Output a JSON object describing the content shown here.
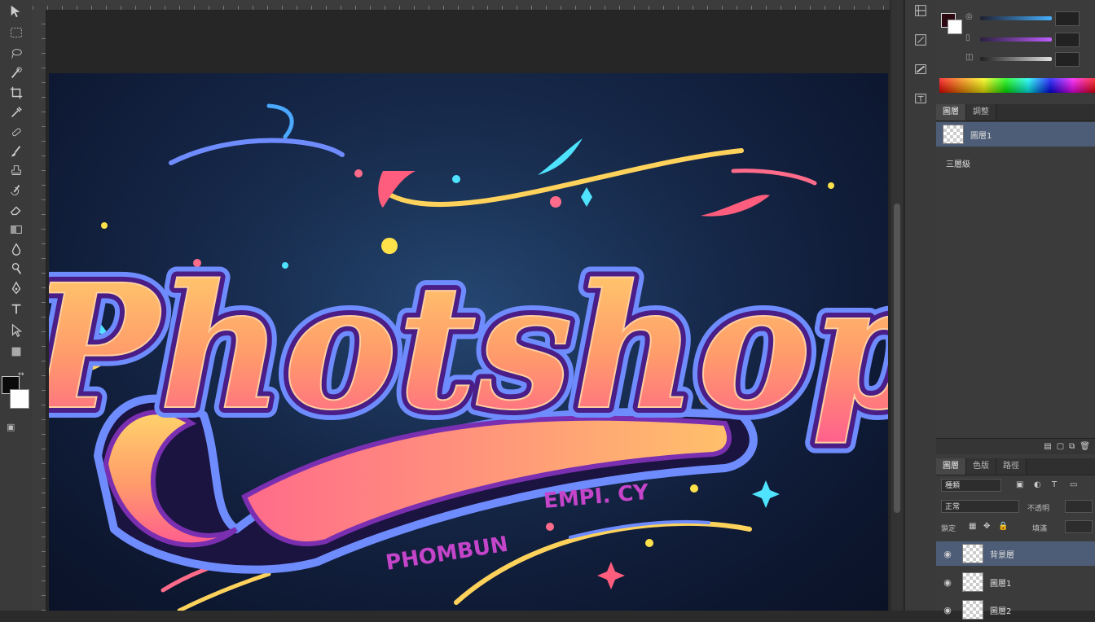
{
  "canvas": {
    "headline": "Photshop",
    "subtitle_arc": "PHOMBUN",
    "subtitle_ribbon": "EMPI. CY",
    "colors": {
      "background": "#0d1730",
      "letter_fill_top": "#ffd36b",
      "letter_fill_bottom": "#ff6b8a",
      "outline_inner": "#6a2a9a",
      "outline_outer": "#6f8cff",
      "subtitle": "#c445c9"
    }
  },
  "toolbar": {
    "tools": [
      "move-tool",
      "marquee-tool",
      "lasso-tool",
      "quick-select-tool",
      "crop-tool",
      "eyedropper-tool",
      "healing-brush-tool",
      "brush-tool",
      "clone-stamp-tool",
      "history-brush-tool",
      "eraser-tool",
      "gradient-tool",
      "blur-tool",
      "dodge-tool",
      "pen-tool",
      "type-tool",
      "path-select-tool",
      "shape-tool",
      "hand-tool",
      "zoom-tool"
    ]
  },
  "color_panel": {
    "sliders": [
      {
        "label": "◎",
        "value": "",
        "color_start": "#202030",
        "color_end": "#45b0ff"
      },
      {
        "label": "▯",
        "value": "",
        "color_start": "#2a2040",
        "color_end": "#c05cff"
      },
      {
        "label": "◫",
        "value": "",
        "color_start": "#202020",
        "color_end": "#e0e0e0"
      }
    ],
    "foreground_color": "#2a0a10",
    "background_color": "#ffffff"
  },
  "swatches_panel": {
    "tabs": [
      "圖層",
      "調整"
    ],
    "rows": [
      {
        "label": "圖層1"
      },
      {
        "label": "三層級"
      }
    ]
  },
  "layers_panel": {
    "tabs": [
      "圖層",
      "色版",
      "路徑"
    ],
    "blend_mode": "正常",
    "opacity_label": "不透明",
    "fill_label": "填滿",
    "lock_label": "鎖定",
    "kind_label": "種類",
    "layers": [
      {
        "name": "背景層",
        "visible": true,
        "selected": true
      },
      {
        "name": "圖層1",
        "visible": true,
        "selected": false
      },
      {
        "name": "圖層2",
        "visible": true,
        "selected": false
      }
    ]
  }
}
